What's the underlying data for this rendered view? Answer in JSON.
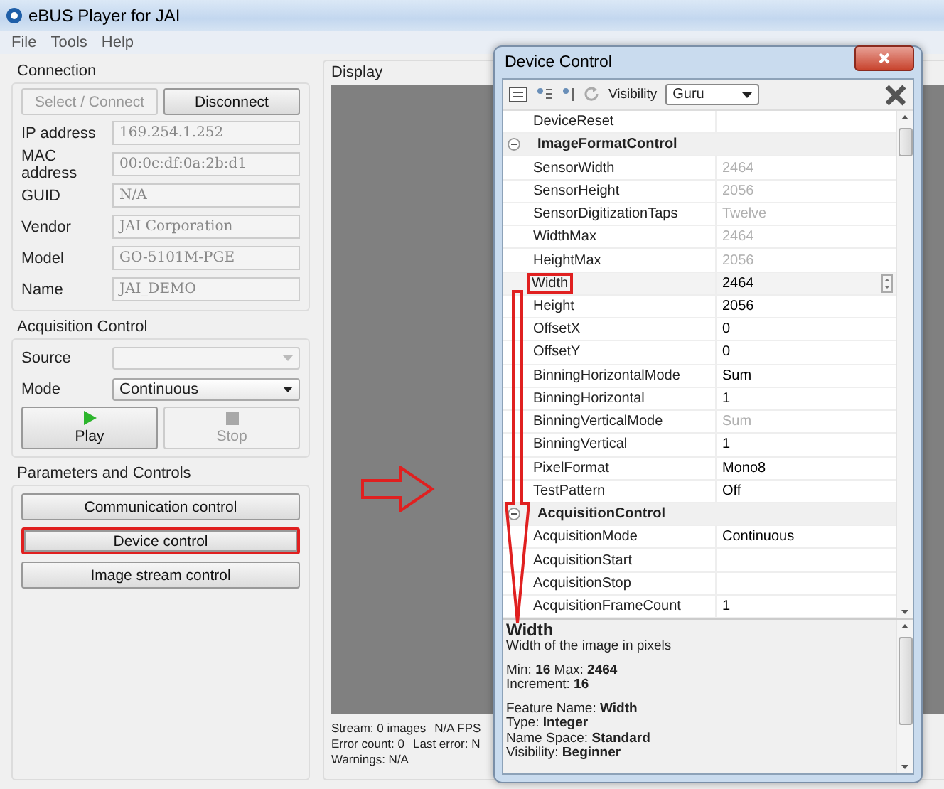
{
  "window": {
    "title": "eBUS Player for JAI"
  },
  "menu": [
    "File",
    "Tools",
    "Help"
  ],
  "connection": {
    "title": "Connection",
    "buttons": [
      {
        "label": "Select / Connect",
        "disabled": true
      },
      {
        "label": "Disconnect",
        "disabled": false
      }
    ],
    "fields": [
      {
        "label": "IP address",
        "value": "169.254.1.252"
      },
      {
        "label": "MAC address",
        "value": "00:0c:df:0a:2b:d1"
      },
      {
        "label": "GUID",
        "value": "N/A"
      },
      {
        "label": "Vendor",
        "value": "JAI Corporation"
      },
      {
        "label": "Model",
        "value": "GO-5101M-PGE"
      },
      {
        "label": "Name",
        "value": "JAI_DEMO"
      }
    ]
  },
  "acquisition": {
    "title": "Acquisition Control",
    "combos": [
      {
        "label": "Source",
        "disabled": true
      },
      {
        "label": "Mode",
        "value": "Continuous",
        "disabled": false
      }
    ],
    "buttons": [
      {
        "kind": "play",
        "label": "Play",
        "disabled": false
      },
      {
        "kind": "stop",
        "label": "Stop",
        "disabled": true
      }
    ]
  },
  "parameters": {
    "title": "Parameters and Controls",
    "buttons": [
      {
        "label": "Communication control",
        "highlighted": false
      },
      {
        "label": "Device control",
        "highlighted": true
      },
      {
        "label": "Image stream control",
        "highlighted": false
      }
    ]
  },
  "display": {
    "title": "Display",
    "status": [
      [
        "Stream: 0 images",
        "N/A FPS"
      ],
      [
        "Error count: 0",
        "Last error: N"
      ],
      [
        "Warnings: N/A"
      ]
    ]
  },
  "device_control": {
    "title": "Device Control",
    "visibility_label": "Visibility",
    "visibility": "Guru",
    "rows": [
      {
        "kind": "property",
        "name": "DeviceReset",
        "selected": false,
        "highlighted": false
      },
      {
        "kind": "category",
        "name": "ImageFormatControl",
        "expanded": true
      },
      {
        "kind": "property",
        "name": "SensorWidth",
        "value": "2464",
        "readonly": true,
        "selected": false,
        "highlighted": false
      },
      {
        "kind": "property",
        "name": "SensorHeight",
        "value": "2056",
        "readonly": true,
        "selected": false,
        "highlighted": false
      },
      {
        "kind": "property",
        "name": "SensorDigitizationTaps",
        "value": "Twelve",
        "readonly": true,
        "selected": false,
        "highlighted": false
      },
      {
        "kind": "property",
        "name": "WidthMax",
        "value": "2464",
        "readonly": true,
        "selected": false,
        "highlighted": false
      },
      {
        "kind": "property",
        "name": "HeightMax",
        "value": "2056",
        "readonly": true,
        "selected": false,
        "highlighted": false
      },
      {
        "kind": "property",
        "name": "Width",
        "value": "2464",
        "readonly": false,
        "selected": true,
        "highlighted": true
      },
      {
        "kind": "property",
        "name": "Height",
        "value": "2056",
        "readonly": false,
        "selected": false,
        "highlighted": false
      },
      {
        "kind": "property",
        "name": "OffsetX",
        "value": "0",
        "readonly": false,
        "selected": false,
        "highlighted": false
      },
      {
        "kind": "property",
        "name": "OffsetY",
        "value": "0",
        "readonly": false,
        "selected": false,
        "highlighted": false
      },
      {
        "kind": "property",
        "name": "BinningHorizontalMode",
        "value": "Sum",
        "readonly": false,
        "selected": false,
        "highlighted": false
      },
      {
        "kind": "property",
        "name": "BinningHorizontal",
        "value": "1",
        "readonly": false,
        "selected": false,
        "highlighted": false
      },
      {
        "kind": "property",
        "name": "BinningVerticalMode",
        "value": "Sum",
        "readonly": true,
        "selected": false,
        "highlighted": false
      },
      {
        "kind": "property",
        "name": "BinningVertical",
        "value": "1",
        "readonly": false,
        "selected": false,
        "highlighted": false
      },
      {
        "kind": "property",
        "name": "PixelFormat",
        "value": "Mono8",
        "readonly": false,
        "selected": false,
        "highlighted": false
      },
      {
        "kind": "property",
        "name": "TestPattern",
        "value": "Off",
        "readonly": false,
        "selected": false,
        "highlighted": false
      },
      {
        "kind": "category",
        "name": "AcquisitionControl",
        "expanded": true
      },
      {
        "kind": "property",
        "name": "AcquisitionMode",
        "value": "Continuous",
        "readonly": false,
        "selected": false,
        "highlighted": false
      },
      {
        "kind": "property",
        "name": "AcquisitionStart",
        "selected": false,
        "highlighted": false
      },
      {
        "kind": "property",
        "name": "AcquisitionStop",
        "selected": false,
        "highlighted": false
      },
      {
        "kind": "property",
        "name": "AcquisitionFrameCount",
        "value": "1",
        "readonly": false,
        "selected": false,
        "highlighted": false
      }
    ],
    "info": {
      "title": "Width",
      "description": "Width of the image in pixels",
      "details": [
        [
          "Min: **16** Max: **2464**",
          "Increment: **16**"
        ],
        [
          "Feature Name: **Width**",
          "Type: **Integer**",
          "Name Space: **Standard**",
          "Visibility: **Beginner**"
        ]
      ]
    }
  }
}
